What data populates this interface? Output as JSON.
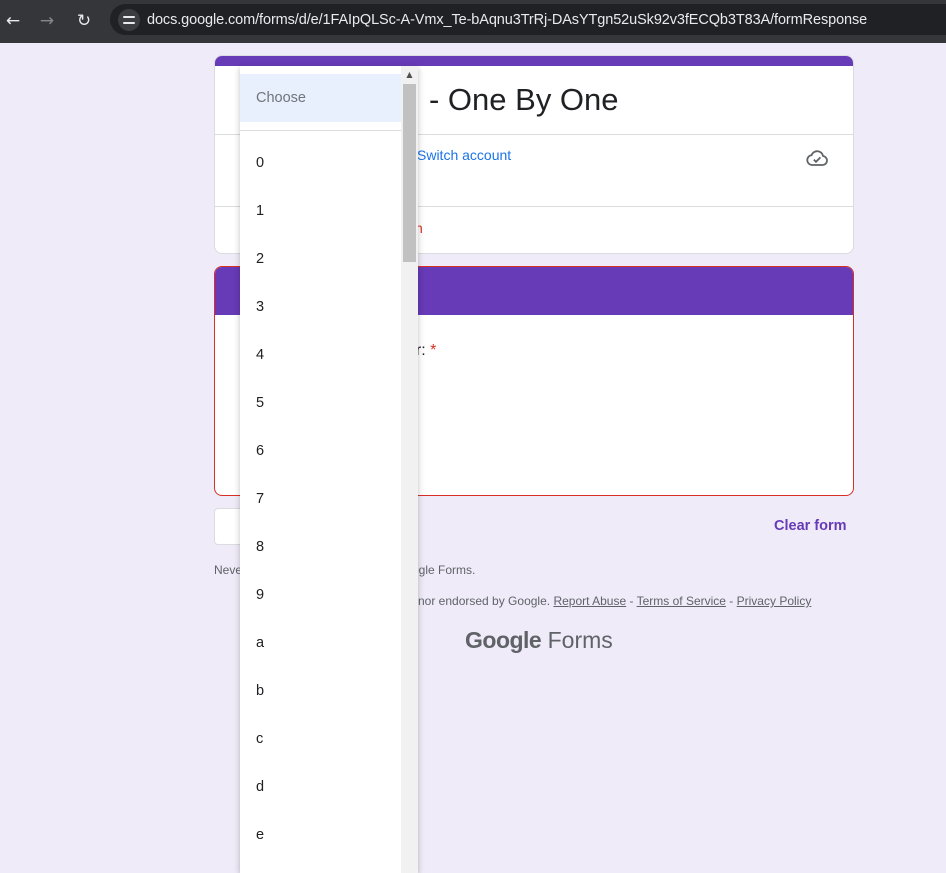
{
  "browser": {
    "url_host": "docs.google.com",
    "url_path": "/forms/d/e/1FAIpQLSc-A-Vmx_Te-bAqnu3TrRj-DAsYTgn52uSk92v3fECQb3T83A/formResponse"
  },
  "header": {
    "title": "- One By One",
    "switch_account": "Switch account",
    "required_note": "n"
  },
  "section": {
    "question_label": "er: ",
    "required_star": "*",
    "error_note": "n"
  },
  "footer": {
    "clear_form": "Clear form",
    "never_prefix": "Neve",
    "gf_text": "ogle Forms.",
    "disclaimer": "nor endorsed by Google.",
    "report_abuse": "Report Abuse",
    "sep1": " - ",
    "terms": "Terms of Service",
    "sep2": " - ",
    "privacy": "Privacy Policy",
    "brand_google": "Google",
    "brand_forms": " Forms"
  },
  "dropdown": {
    "placeholder": "Choose",
    "options": [
      "0",
      "1",
      "2",
      "3",
      "4",
      "5",
      "6",
      "7",
      "8",
      "9",
      "a",
      "b",
      "c",
      "d",
      "e"
    ]
  },
  "colors": {
    "accent": "#673ab7",
    "background": "#f0ebf8",
    "error": "#d93025",
    "link": "#1a73e8"
  }
}
